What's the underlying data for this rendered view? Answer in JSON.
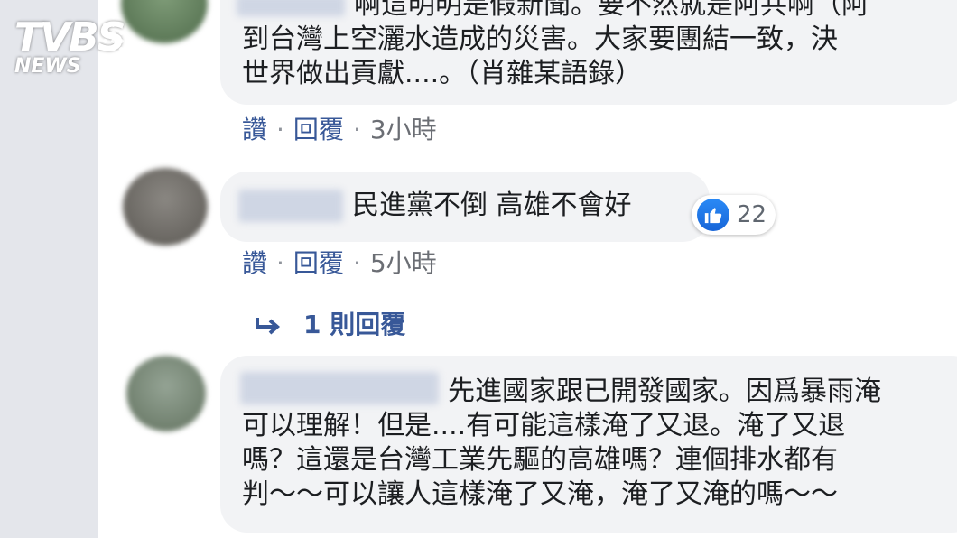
{
  "logo": {
    "brand": "TVBS",
    "sub": "NEWS"
  },
  "comments": [
    {
      "lines": [
        "啊這明明是假新聞。要不然就是阿共啊（阿",
        "到台灣上空灑水造成的災害。大家要團結一致，決",
        "世界做出貢獻....。（肖雜某語錄）"
      ],
      "like_label": "讚",
      "reply_label": "回覆",
      "time": "3小時"
    },
    {
      "lines": [
        "民進黨不倒 高雄不會好"
      ],
      "like_label": "讚",
      "reply_label": "回覆",
      "time": "5小時",
      "reaction_count": "22",
      "replies_label": "1 則回覆"
    },
    {
      "lines": [
        "先進國家跟已開發國家。因爲暴雨淹",
        "可以理解！但是....有可能這樣淹了又退。淹了又退",
        "嗎？這還是台灣工業先驅的高雄嗎？連個排水都有",
        "判～～可以讓人這樣淹了又淹，淹了又淹的嗎～～"
      ]
    }
  ],
  "colors": {
    "link": "#385898",
    "bubble": "#f2f3f5",
    "like": "#1877f2"
  },
  "icons": {
    "like": "thumbs-up-icon",
    "reply_arrow": "reply-arrow-icon"
  }
}
